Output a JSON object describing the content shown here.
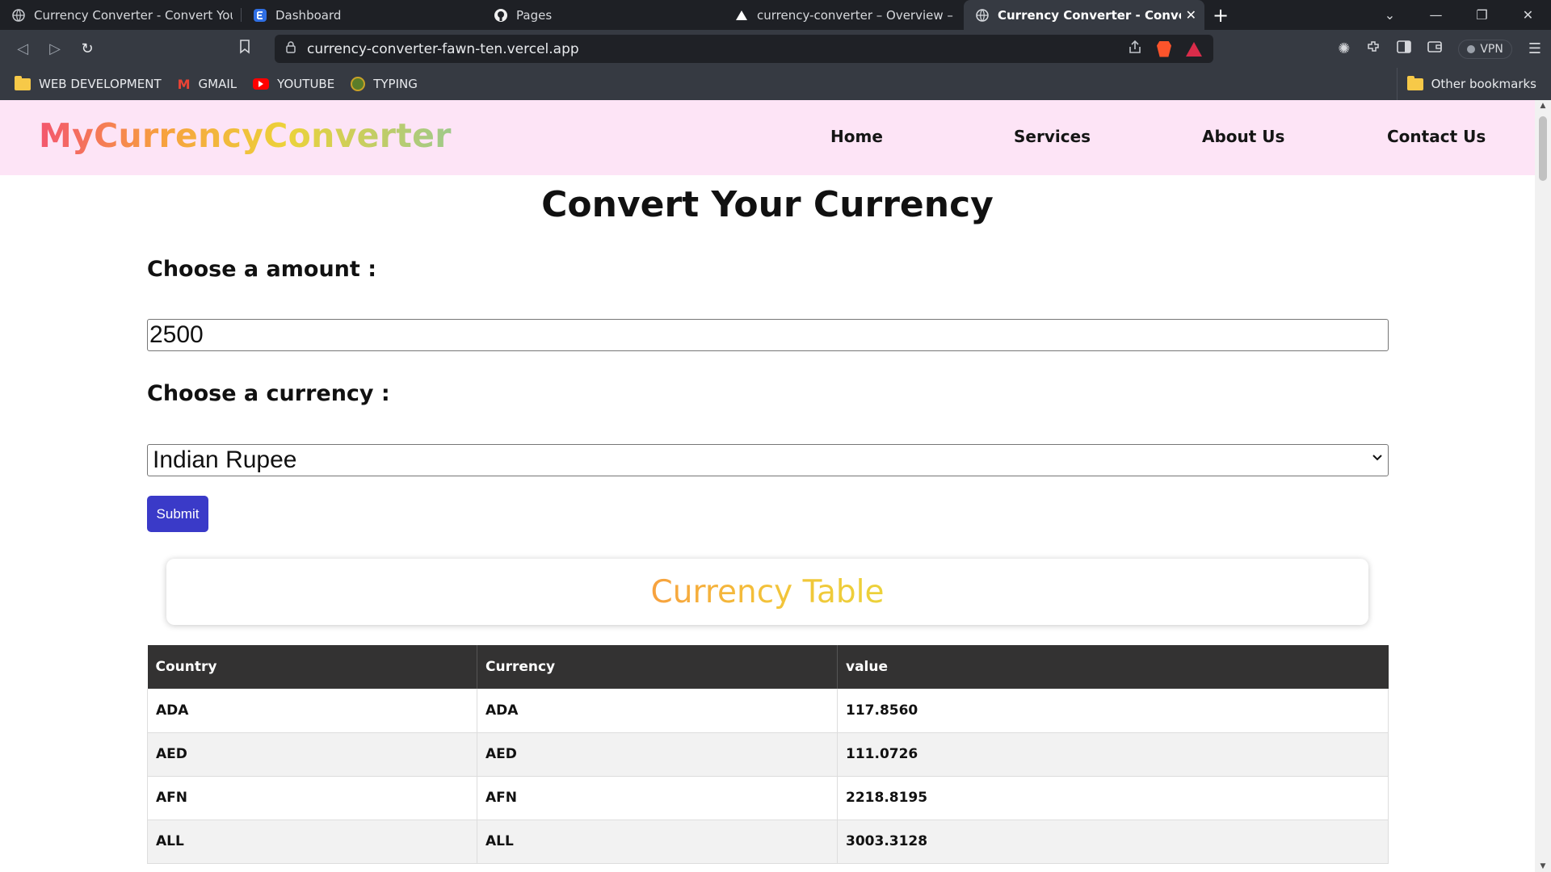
{
  "browser": {
    "tabs": [
      {
        "title": "Currency Converter - Convert Your Currency",
        "active": false,
        "icon": "globe-icon"
      },
      {
        "title": "Dashboard",
        "active": false,
        "icon": "dashboard-icon"
      },
      {
        "title": "Pages",
        "active": false,
        "icon": "github-icon"
      },
      {
        "title": "currency-converter – Overview – Vercel",
        "active": false,
        "icon": "vercel-icon"
      },
      {
        "title": "Currency Converter - Convert Your Currency",
        "active": true,
        "icon": "globe-icon"
      }
    ],
    "url": "currency-converter-fawn-ten.vercel.app",
    "vpn_label": "VPN",
    "bookmarks": [
      {
        "label": "WEB DEVELOPMENT",
        "icon": "folder-icon"
      },
      {
        "label": "GMAIL",
        "icon": "gmail-icon"
      },
      {
        "label": "YOUTUBE",
        "icon": "youtube-icon"
      },
      {
        "label": "TYPING",
        "icon": "typing-icon"
      }
    ],
    "other_bookmarks": "Other bookmarks"
  },
  "site": {
    "logo": "MyCurrencyConverter",
    "nav": [
      "Home",
      "Services",
      "About Us",
      "Contact Us"
    ],
    "title": "Convert Your Currency",
    "amount_label": "Choose a amount :",
    "amount_value": "2500",
    "currency_label": "Choose a currency :",
    "currency_selected": "Indian Rupee",
    "submit_label": "Submit",
    "table_title": "Currency Table",
    "table": {
      "headers": [
        "Country",
        "Currency",
        "value"
      ],
      "rows": [
        [
          "ADA",
          "ADA",
          "117.8560"
        ],
        [
          "AED",
          "AED",
          "111.0726"
        ],
        [
          "AFN",
          "AFN",
          "2218.8195"
        ],
        [
          "ALL",
          "ALL",
          "3003.3128"
        ]
      ]
    }
  },
  "colors": {
    "nav_bg": "#fde4f6",
    "submit_bg": "#3a3ac8",
    "table_header_bg": "#333232",
    "card_title": "#f7b93a"
  }
}
